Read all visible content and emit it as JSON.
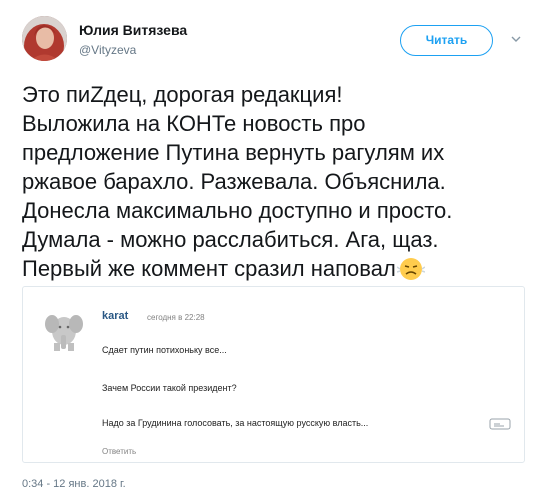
{
  "tweet": {
    "author_name": "Юлия Витязева",
    "author_handle": "@Vityzeva",
    "follow_label": "Читать",
    "text_lines": [
      "Это пиZдец, дорогая редакция!",
      "Выложила на КОНТе новость про",
      "предложение Путина вернуть рагулям их",
      "ржавое барахло. Разжевала. Объяснила.",
      "Донесла максимально доступно и просто.",
      "Думала - можно расслабиться. Ага, щаз.",
      "Первый же коммент сразил наповал"
    ],
    "timestamp": "0:34 - 12 янв. 2018 г."
  },
  "embedded_comment": {
    "username": "karat",
    "time": "сегодня в 22:28",
    "lines": [
      "Сдает путин потихоньку все...",
      "Зачем России такой президент?",
      "Надо за Грудинина голосовать, за настоящую русскую власть..."
    ],
    "reply_label": "Ответить"
  },
  "colors": {
    "accent": "#1da1f2",
    "text": "#14171a",
    "muted": "#657786",
    "vk_link": "#2a5885"
  }
}
